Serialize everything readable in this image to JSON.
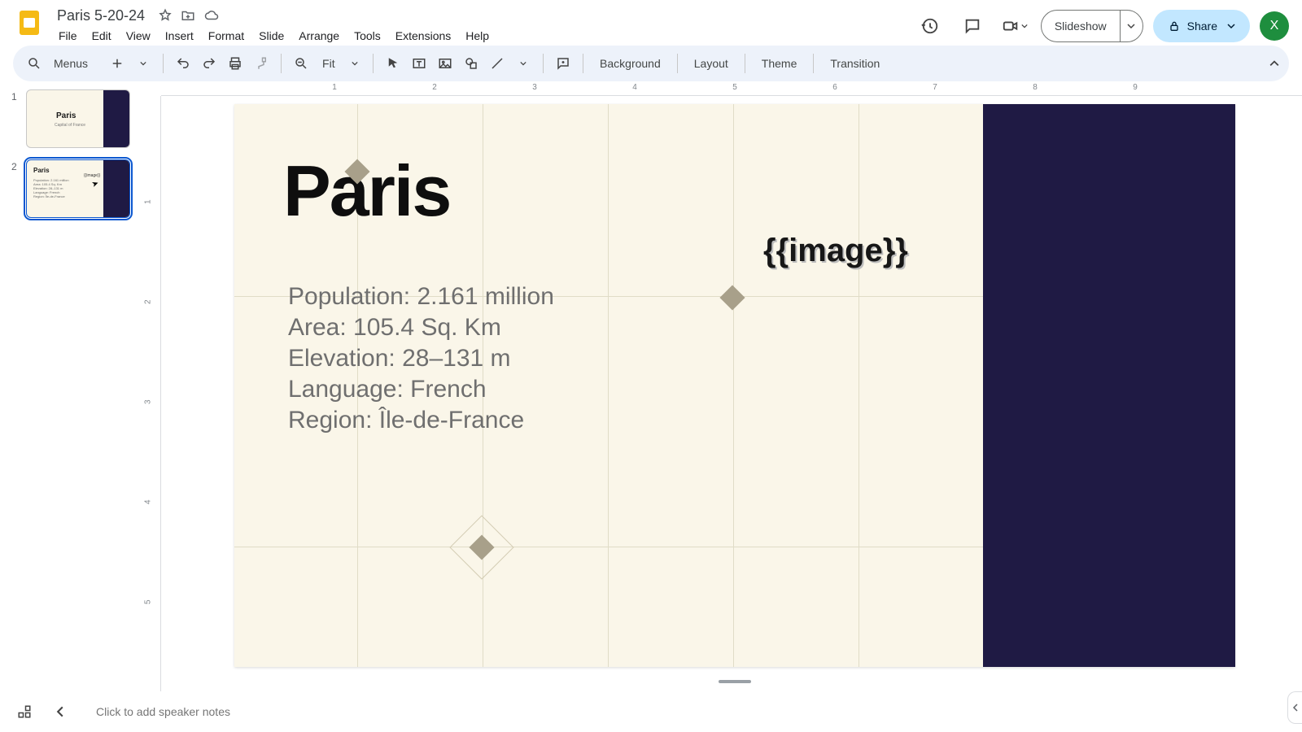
{
  "doc": {
    "title": "Paris 5-20-24"
  },
  "menus": {
    "file": "File",
    "edit": "Edit",
    "view": "View",
    "insert": "Insert",
    "format": "Format",
    "slide": "Slide",
    "arrange": "Arrange",
    "tools": "Tools",
    "extensions": "Extensions",
    "help": "Help"
  },
  "toolbar": {
    "menus_label": "Menus",
    "zoom": "Fit",
    "background": "Background",
    "layout": "Layout",
    "theme": "Theme",
    "transition": "Transition"
  },
  "header": {
    "slideshow": "Slideshow",
    "share": "Share",
    "avatar": "X"
  },
  "ruler": {
    "h": [
      "1",
      "2",
      "3",
      "4",
      "5",
      "6",
      "7",
      "8",
      "9"
    ],
    "v": [
      "1",
      "2",
      "3",
      "4",
      "5"
    ]
  },
  "filmstrip": {
    "items": [
      {
        "n": "1",
        "title": "Paris",
        "sub": "Capital of France"
      },
      {
        "n": "2",
        "title": "Paris",
        "lines": "Population: 2.161 million\nArea: 105.4 Sq. Km\nElevation: 28–131 m\nLanguage: French\nRegion: Île-de-France",
        "img": "{{image}}"
      }
    ]
  },
  "slide": {
    "title": "Paris",
    "body": {
      "l1": "Population: 2.161 million",
      "l2": "Area: 105.4 Sq. Km",
      "l3": "Elevation: 28–131 m",
      "l4": "Language: French",
      "l5": "Region: Île-de-France"
    },
    "image_placeholder": "{{image}}"
  },
  "notes": {
    "placeholder": "Click to add speaker notes"
  },
  "colors": {
    "accent": "#1f1a44",
    "bg": "#faf6e9"
  }
}
